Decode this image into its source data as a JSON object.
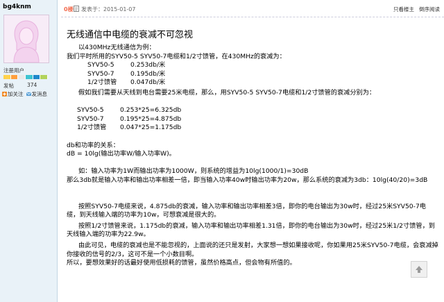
{
  "sidebar": {
    "username": "bg4knm",
    "role": "注册用户",
    "posts_label": "发帖",
    "posts_count": "374",
    "follow_label": "加关注",
    "message_label": "发消息",
    "level_colors": [
      "#ffd24d",
      "#ff9f3d",
      "#e9e9e9",
      "#3ec4d1",
      "#1e88cc",
      "#b2d35c"
    ]
  },
  "topbar": {
    "floor": "0楼",
    "posted": "发表于：2015-01-07",
    "only_author": "只看楼主",
    "reverse": "倒序阅读"
  },
  "post": {
    "title": "无线通信中电缆的衰减不可忽视",
    "l1": "以430MHz无线通信为例：",
    "l2": "我们平时所用的SYV50-5 SYV50-7电缆和1/2寸馈管，在430MHz的衰减为：",
    "table1": [
      {
        "name": "SYV50-5",
        "value": "0.253db/米"
      },
      {
        "name": "SYV50-7",
        "value": "0.195db/米"
      },
      {
        "name": "1/2寸馈管",
        "value": "0.047db/米"
      }
    ],
    "l3": "假如我们需要从天线到电台需要25米电缆，那么，用SYV50-5 SYV50-7电缆和1/2寸馈管的衰减分别为：",
    "table2": [
      {
        "name": "SYV50-5",
        "value": "0.253*25=6.325db"
      },
      {
        "name": "SYV50-7",
        "value": "0.195*25=4.875db"
      },
      {
        "name": "1/2寸馈管",
        "value": "0.047*25=1.175db"
      }
    ],
    "l4": "db和功率的关系：",
    "l5": "dB = 10lg(输出功率W/输入功率W)。",
    "l6": "如：输入功率为1W而输出功率为1000W，则系统的增益为10lg(1000/1)=30dB",
    "l7": "那么3db就是输入功率和输出功率相差一倍，即当输入功率40w时输出功率为20w，那么系统的衰减为3db：10lg(40/20)=3dB",
    "l8": "按照SYV50-7电缆来说，4.875db的衰减，输入功率和输出功率相差3倍，即你的电台输出为30w时，经过25米SYV50-7电缆，到天线输入端的功率为10w，可想衰减是很大的。",
    "l9": "按照1/2寸馈管来说，1.175db的衰减，输入功率和输出功率相差1.31倍，即你的电台输出为30w时，经过25米1/2寸馈管，到天线输入端的功率为22.9w。",
    "l10": "由此可见，电缆的衰减也是不能忽视的，上面说的还只是发射，大家想一想如果接收呢，你如果用25米SYV50-7电缆，会衰减掉你接收的信号的2/3，这可不是一个小数目啊。",
    "l11": "所以，要想效果好的话最好使用低损耗的馈管，虽然价格高点，但会物有所值的。"
  }
}
